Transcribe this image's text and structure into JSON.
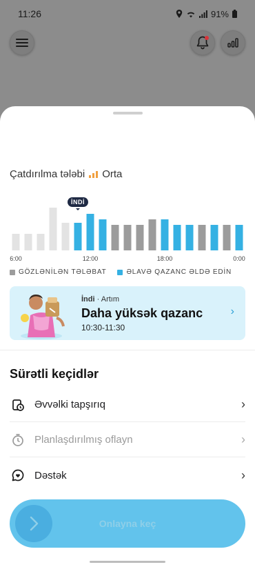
{
  "status_bar": {
    "time": "11:26",
    "battery": "91%"
  },
  "header": {
    "menu_icon": "hamburger-icon",
    "bell_icon": "bell-icon",
    "signal_icon": "signal-bars-icon"
  },
  "demand": {
    "label": "Çatdırılma tələbi",
    "value": "Orta",
    "color": "#f0a040"
  },
  "chart_data": {
    "type": "bar",
    "x_ticks": [
      "6:00",
      "12:00",
      "18:00",
      "0:00"
    ],
    "now_label": "İNDİ",
    "now_index": 5,
    "bars": [
      {
        "level": 0.38,
        "kind": "past"
      },
      {
        "level": 0.38,
        "kind": "past"
      },
      {
        "level": 0.38,
        "kind": "past"
      },
      {
        "level": 1.0,
        "kind": "past"
      },
      {
        "level": 0.65,
        "kind": "past"
      },
      {
        "level": 0.65,
        "kind": "extra"
      },
      {
        "level": 0.86,
        "kind": "extra"
      },
      {
        "level": 0.72,
        "kind": "extra"
      },
      {
        "level": 0.6,
        "kind": "expected"
      },
      {
        "level": 0.6,
        "kind": "expected"
      },
      {
        "level": 0.6,
        "kind": "expected"
      },
      {
        "level": 0.72,
        "kind": "expected"
      },
      {
        "level": 0.72,
        "kind": "extra"
      },
      {
        "level": 0.6,
        "kind": "extra"
      },
      {
        "level": 0.6,
        "kind": "extra"
      },
      {
        "level": 0.6,
        "kind": "expected"
      },
      {
        "level": 0.6,
        "kind": "extra"
      },
      {
        "level": 0.6,
        "kind": "expected"
      },
      {
        "level": 0.6,
        "kind": "extra"
      }
    ],
    "colors": {
      "past": "#e3e3e3",
      "expected": "#9c9c9c",
      "extra": "#35b1e3"
    },
    "legend": [
      {
        "label": "GÖZLƏNİLƏN TƏLƏBAT",
        "color": "#9c9c9c"
      },
      {
        "label": "ƏLAVƏ QAZANC ƏLDƏ EDİN",
        "color": "#35b1e3"
      }
    ]
  },
  "promo": {
    "tag": "İndi",
    "subtag": "· Artım",
    "title": "Daha yüksək qazanc",
    "time": "10:30-11:30",
    "chevron": "›"
  },
  "quick_links": {
    "title": "Sürətli keçidlər",
    "items": [
      {
        "label": "Əvvəlki tapşırıq",
        "icon": "past-task-icon",
        "chevron": "›"
      },
      {
        "label": "Planlaşdırılmış oflayn",
        "icon": "timer-icon",
        "chevron": "›"
      },
      {
        "label": "Dəstək",
        "icon": "support-chat-icon",
        "chevron": "›"
      }
    ]
  },
  "go_online": {
    "label": "Onlayna keç",
    "knob_icon": "chevron-right-icon"
  }
}
